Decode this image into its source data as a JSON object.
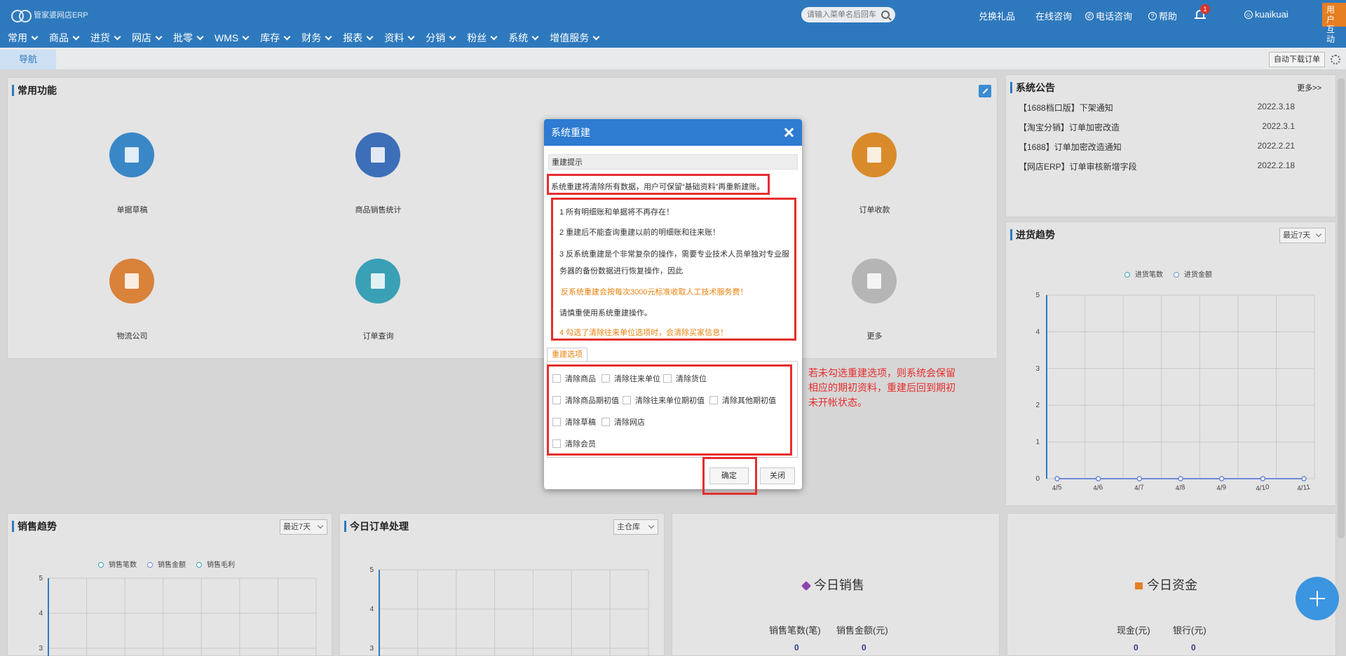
{
  "app": {
    "logo_text": "管家婆网店ERP",
    "search_placeholder": "请输入菜单名后回车",
    "links": {
      "gift": "兑换礼品",
      "online": "在线咨询",
      "phone": "电话咨询",
      "help": "帮助",
      "user": "kuaikuai"
    },
    "bell_count": "1",
    "user_tab": "用户互动"
  },
  "menu": [
    "常用",
    "商品",
    "进货",
    "网店",
    "批零",
    "WMS",
    "库存",
    "财务",
    "报表",
    "资料",
    "分销",
    "粉丝",
    "系统",
    "增值服务"
  ],
  "tabbar": {
    "nav": "导航",
    "auto_download": "自动下载订单"
  },
  "common": {
    "title": "常用功能",
    "items": [
      {
        "label": "单据草稿",
        "color": "#3a87c8"
      },
      {
        "label": "商品销售统计",
        "color": "#3c6fb8"
      },
      {
        "label": "订单收款",
        "color": "#d98b2b"
      },
      {
        "label": "物流公司",
        "color": "#d9823a"
      },
      {
        "label": "订单查询",
        "color": "#3aa0b5"
      },
      {
        "label": "更多",
        "color": "#b5b5b5"
      }
    ]
  },
  "notice": {
    "title": "系统公告",
    "more": "更多>>",
    "rows": [
      {
        "text": "【1688档口版】下架通知",
        "date": "2022.3.18"
      },
      {
        "text": "【淘宝分销】订单加密改造",
        "date": "2022.3.1"
      },
      {
        "text": "【1688】订单加密改造通知",
        "date": "2022.2.21"
      },
      {
        "text": "【网店ERP】订单审核新增字段",
        "date": "2022.2.18"
      }
    ]
  },
  "purchase_trend": {
    "title": "进货趋势",
    "range": "最近7天",
    "legend": [
      "进货笔数",
      "进货金额"
    ]
  },
  "sales_trend": {
    "title": "销售趋势",
    "range": "最近7天",
    "legend": [
      "销售笔数",
      "销售金额",
      "销售毛利"
    ]
  },
  "today_orders": {
    "title": "今日订单处理",
    "warehouse": "主仓库"
  },
  "today_sales": {
    "title": "今日销售",
    "count_label": "销售笔数(笔)",
    "amount_label": "销售金额(元)",
    "count": "0",
    "amount": "0"
  },
  "today_funds": {
    "title": "今日资金",
    "cash_label": "现金(元)",
    "bank_label": "银行(元)",
    "cash": "0",
    "bank": "0"
  },
  "dialog": {
    "title": "系统重建",
    "section": "重建提示",
    "summary": "系统重建将清除所有数据，用户可保留“基础资料”再重新建账。",
    "tips": [
      "1 所有明细账和单据将不再存在！",
      "2 重建后不能查询重建以前的明细账和往来账！",
      "3 反系统重建是个非常复杂的操作，需要专业技术人员单独对专业服",
      "务器的备份数据进行恢复操作，因此",
      "反系统重建会按每次3000元标准收取人工技术服务费！",
      "请慎重使用系统重建操作。",
      "4 勾选了清除往来单位选项时，会清除买家信息！"
    ],
    "options_tab": "重建选项",
    "options": [
      [
        "清除商品",
        "清除往来单位",
        "清除货位"
      ],
      [
        "清除商品期初值",
        "清除往来单位期初值",
        "清除其他期初值"
      ],
      [
        "清除草稿",
        "清除网店"
      ],
      [
        "清除会员"
      ]
    ],
    "confirm": "确定",
    "close": "关闭"
  },
  "annotation": "若未勾选重建选项，则系统会保留相应的期初资料，重建后回到期初未开帐状态。",
  "chart_data": [
    {
      "type": "line",
      "title": "进货趋势",
      "categories": [
        "4/5",
        "4/6",
        "4/7",
        "4/8",
        "4/9",
        "4/10",
        "4/11"
      ],
      "series": [
        {
          "name": "进货笔数",
          "values": [
            0,
            0,
            0,
            0,
            0,
            0,
            0
          ]
        },
        {
          "name": "进货金额",
          "values": [
            0,
            0,
            0,
            0,
            0,
            0,
            0
          ]
        }
      ],
      "ylim": [
        0,
        5
      ],
      "yticks": [
        0,
        1,
        2,
        3,
        4,
        5
      ],
      "grid": true,
      "legend": "top-center"
    },
    {
      "type": "line",
      "title": "销售趋势",
      "series": [
        {
          "name": "销售笔数",
          "values": []
        },
        {
          "name": "销售金额",
          "values": []
        },
        {
          "name": "销售毛利",
          "values": []
        }
      ],
      "yticks": [
        3,
        4,
        5
      ],
      "grid": true,
      "legend": "top-center"
    },
    {
      "type": "line",
      "title": "今日订单处理",
      "yticks": [
        3,
        4,
        5
      ],
      "grid": true
    }
  ]
}
